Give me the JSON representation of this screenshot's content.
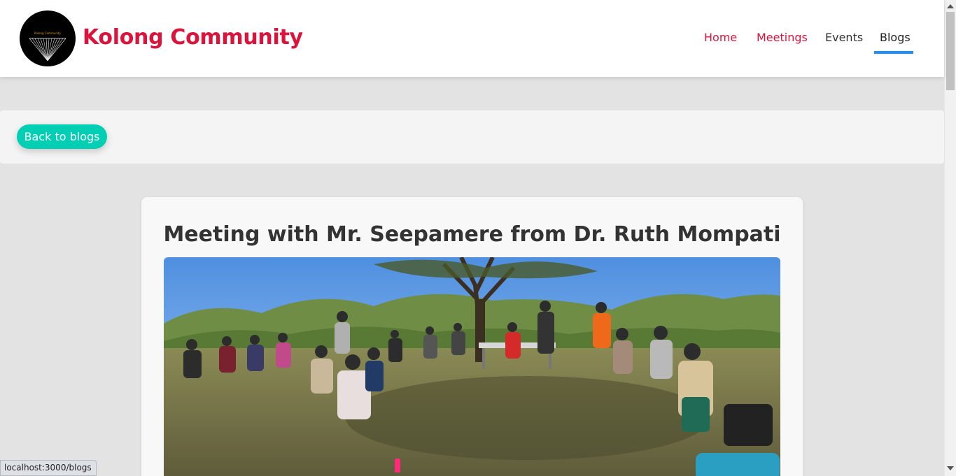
{
  "header": {
    "logo_text": "Kolong Community",
    "brand": "Kolong Community",
    "nav": [
      {
        "label": "Home"
      },
      {
        "label": "Meetings"
      },
      {
        "label": "Events"
      },
      {
        "label": "Blogs",
        "active": true
      }
    ]
  },
  "back_bar": {
    "button_label": "Back to blogs"
  },
  "post": {
    "title": "Meeting with Mr. Seepamere from Dr. Ruth Mompati"
  },
  "status_bar": {
    "url": "localhost:3000/blogs"
  },
  "colors": {
    "brand": "#dc143c",
    "accent_button": "#00cfb4",
    "nav_underline": "#1e90ff",
    "page_bg": "#e3e3e3"
  }
}
